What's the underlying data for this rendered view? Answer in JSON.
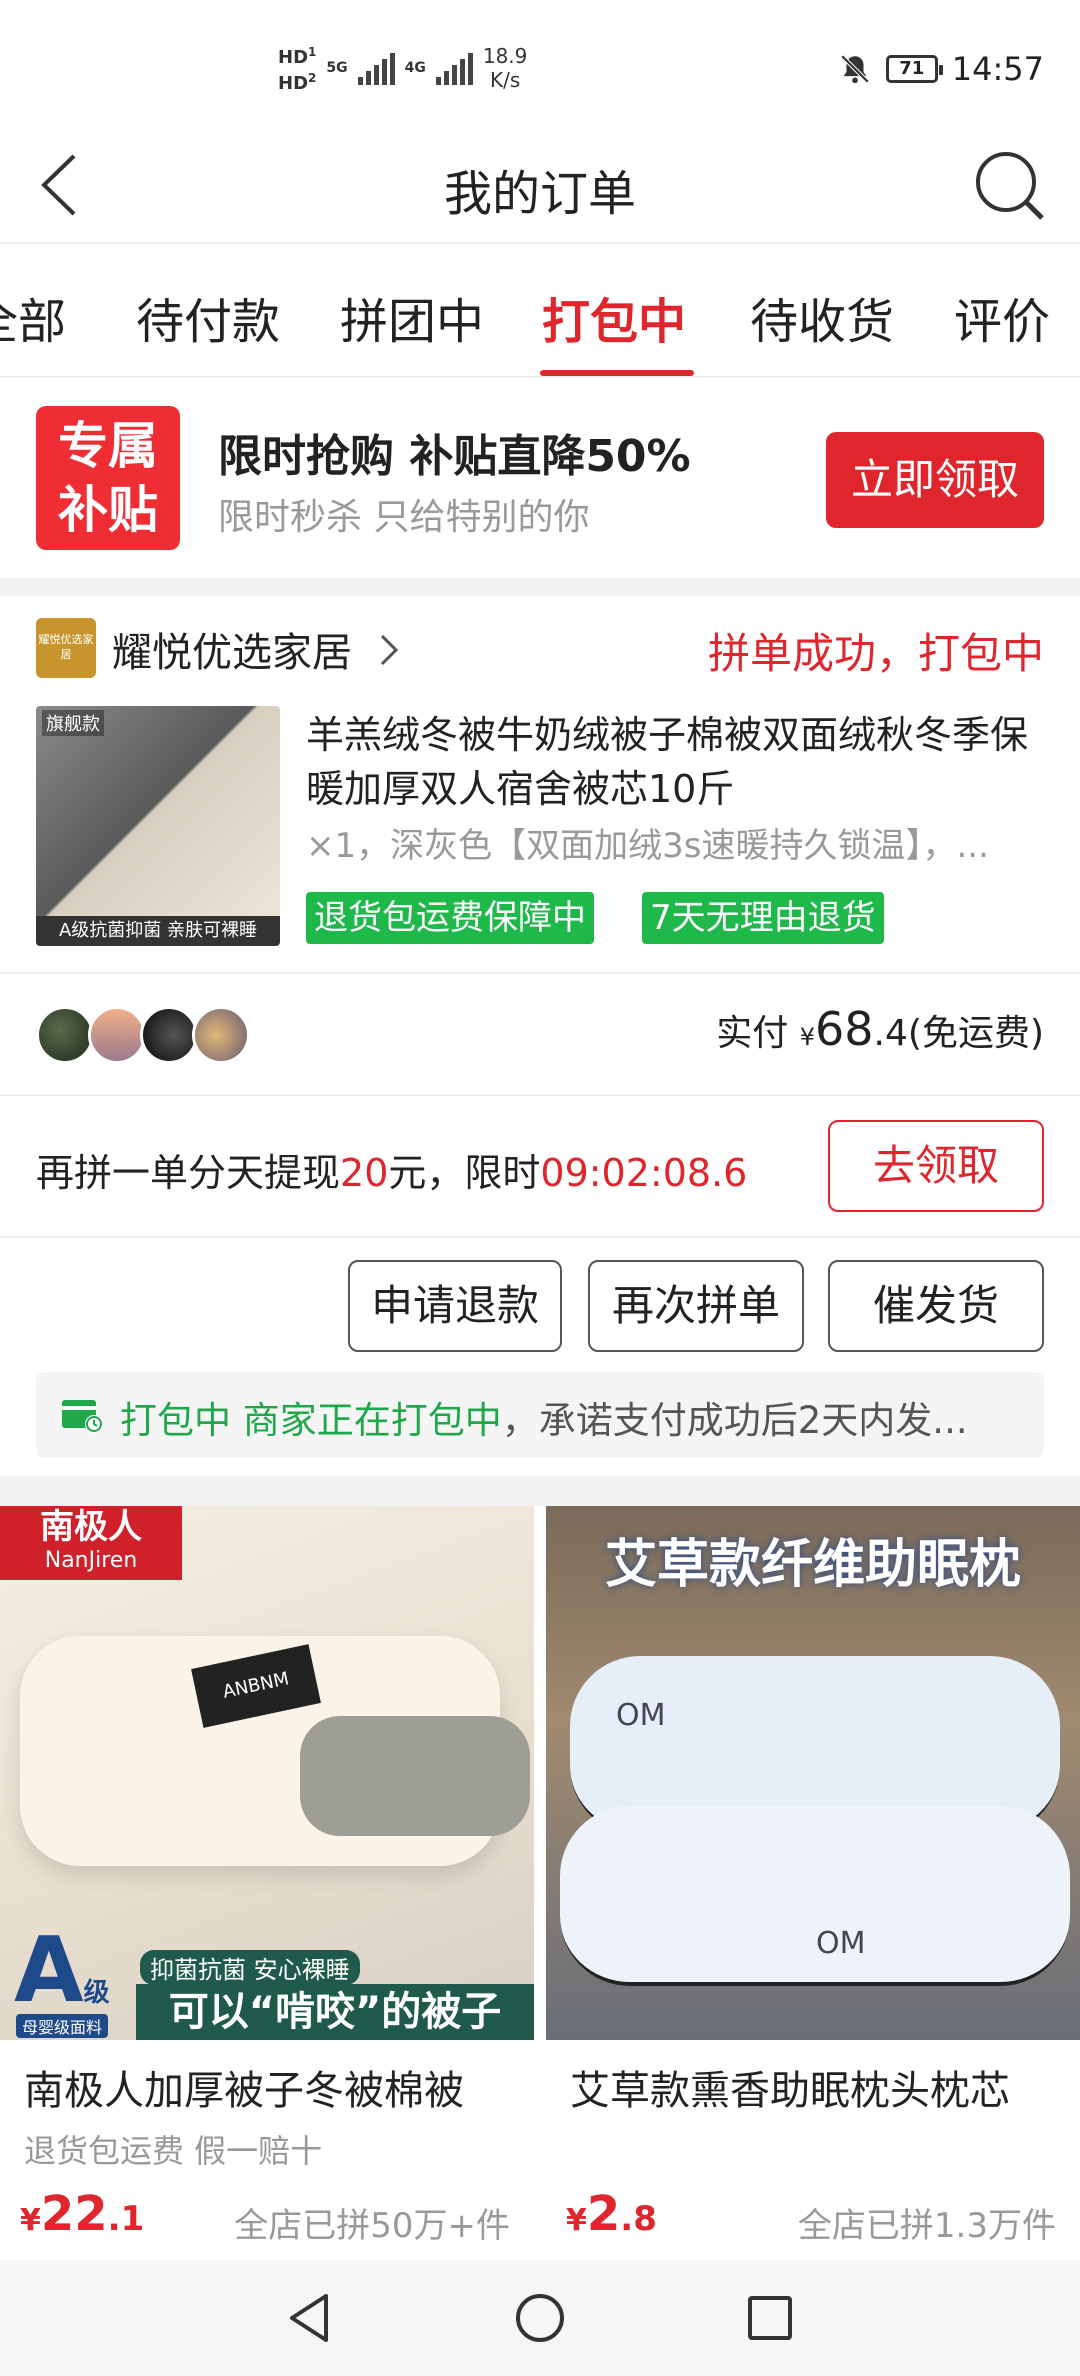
{
  "status_bar": {
    "hd1": "HD",
    "hd2": "HD",
    "sim1": "1",
    "sim2": "2",
    "net1": "5G",
    "net2": "4G",
    "speed_value": "18.9",
    "speed_unit": "K/s",
    "battery": "71",
    "time": "14:57"
  },
  "nav": {
    "title": "我的订单"
  },
  "tabs": [
    {
      "label": "全部"
    },
    {
      "label": "待付款"
    },
    {
      "label": "拼团中"
    },
    {
      "label": "打包中",
      "active": true
    },
    {
      "label": "待收货"
    },
    {
      "label": "评价"
    }
  ],
  "promo": {
    "badge_line1": "专属",
    "badge_line2": "补贴",
    "title": "限时抢购 补贴直降50%",
    "subtitle": "限时秒杀 只给特别的你",
    "button": "立即领取"
  },
  "order": {
    "shop_logo_text": "耀悦优选家居",
    "shop_name": "耀悦优选家居",
    "status": "拼单成功，打包中",
    "image_tag": "旗舰款",
    "image_footer": "A级抗菌抑菌 亲肤可裸睡",
    "title": "羊羔绒冬被牛奶绒被子棉被双面绒秋冬季保暖加厚双人宿舍被芯10斤",
    "sku": "×1，深灰色【双面加绒3s速暖持久锁温】，...",
    "badge1": "退货包运费保障中",
    "badge2": "7天无理由退货",
    "paid_label": "实付",
    "currency": "¥",
    "price_int": "68",
    "price_dec": ".4",
    "shipping": "(免运费)",
    "regroup_prefix": "再拼一单分天提现",
    "regroup_amount": "20",
    "regroup_mid": "元，限时",
    "regroup_timer": "09:02:08.6",
    "claim_button": "去领取",
    "btn_refund": "申请退款",
    "btn_regroup": "再次拼单",
    "btn_urge": "催发货",
    "ship_status": "打包中",
    "ship_detail_green": "商家正在打包中",
    "ship_detail": "，承诺支付成功后2天内发..."
  },
  "recommendations": [
    {
      "brand_tag": "南极人",
      "brand_tag_en": "NanJiren",
      "image_caption_small": "抑菌抗菌 安心裸睡",
      "image_caption": "可以“啃咬”的被子",
      "grade": "A",
      "grade_suffix": "级",
      "grade_note": "母婴级面料",
      "product_label": "ANBNM",
      "name": "南极人加厚被子冬被棉被",
      "sub": "退货包运费  假一赔十",
      "currency": "¥",
      "price_int": "22",
      "price_dec": ".1",
      "sold": "全店已拼50万+件"
    },
    {
      "image_title": "艾草款纤维助眠枕",
      "pillow_logo": "OM",
      "name": "艾草款熏香助眠枕头枕芯",
      "currency": "¥",
      "price_int": "2",
      "price_dec": ".8",
      "sold": "全店已拼1.3万件"
    }
  ],
  "colors": {
    "accent_red": "#e0262d",
    "green": "#1fb84a"
  }
}
